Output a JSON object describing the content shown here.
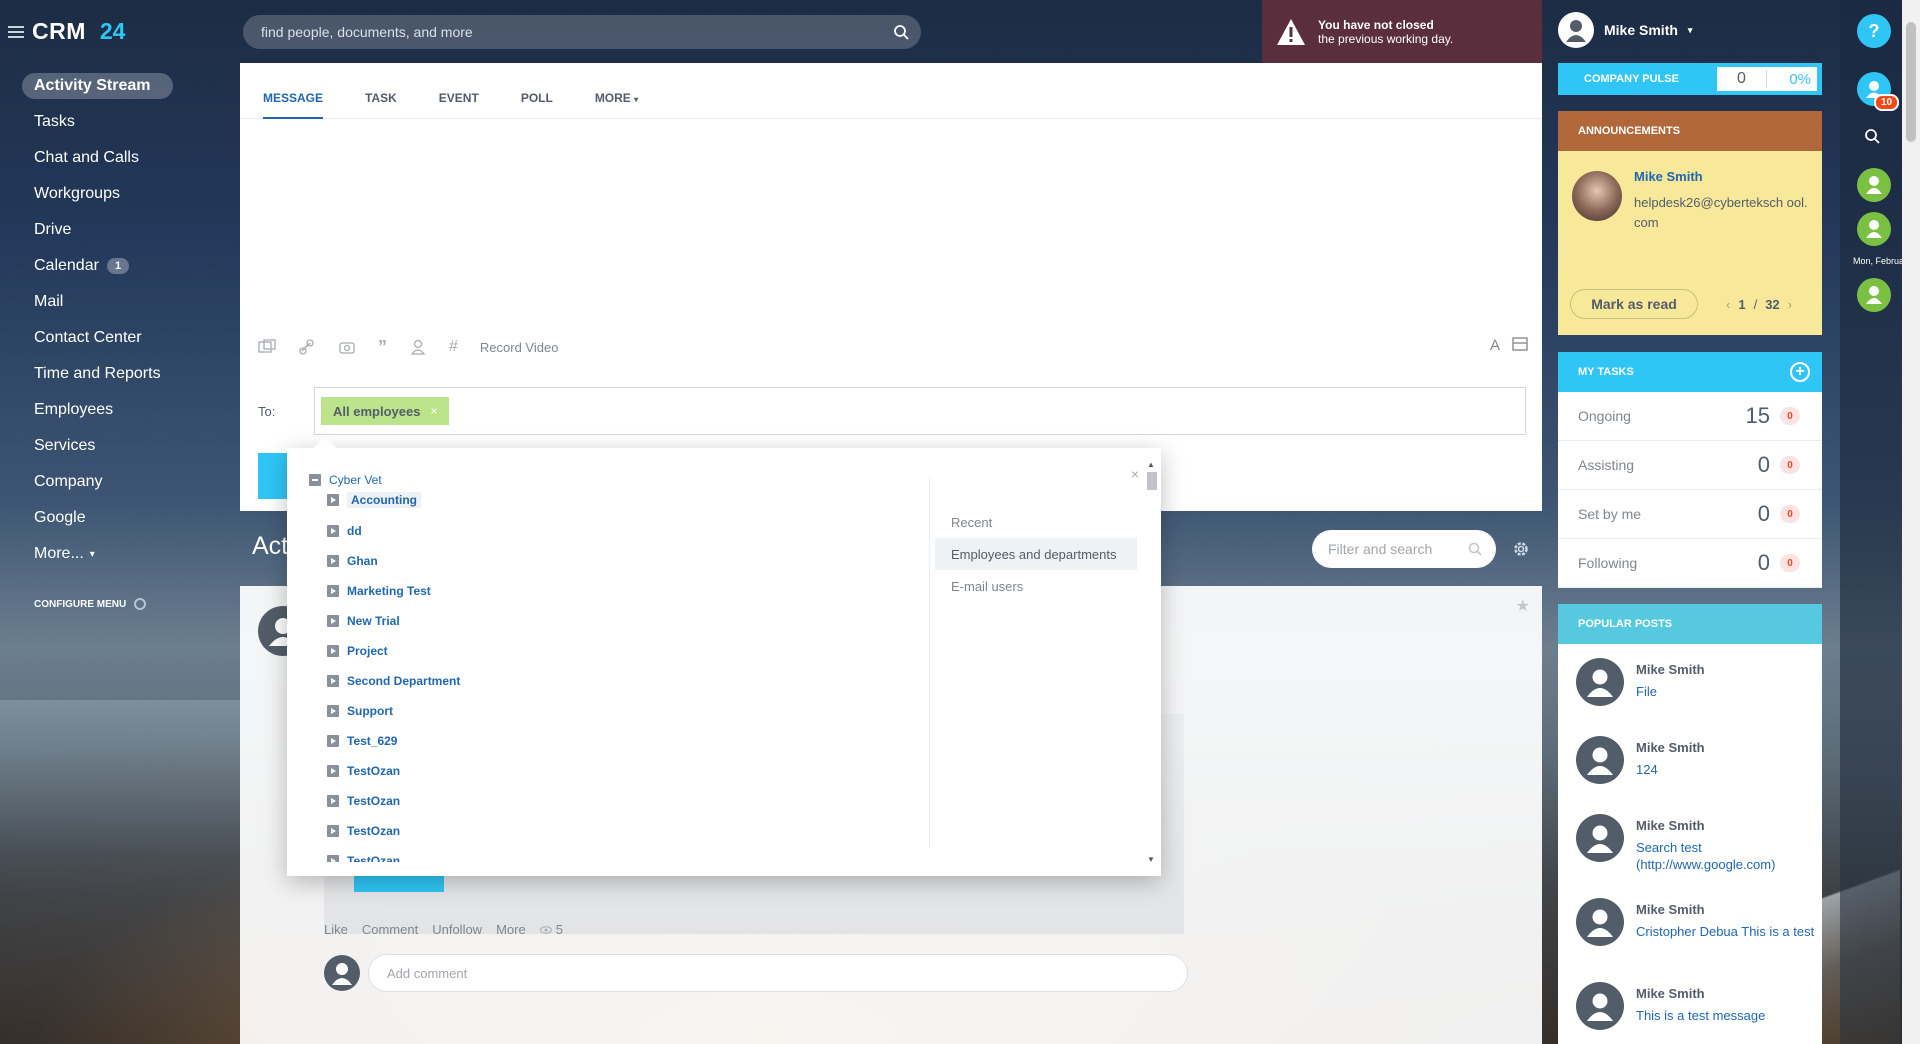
{
  "app": {
    "name": "CRM",
    "name_suffix": "24"
  },
  "leftmenu": {
    "items": [
      {
        "label": "Activity Stream",
        "active": true
      },
      {
        "label": "Tasks"
      },
      {
        "label": "Chat and Calls"
      },
      {
        "label": "Workgroups"
      },
      {
        "label": "Drive"
      },
      {
        "label": "Calendar",
        "counter": "1"
      },
      {
        "label": "Mail"
      },
      {
        "label": "Contact Center"
      },
      {
        "label": "Time and Reports"
      },
      {
        "label": "Employees"
      },
      {
        "label": "Services"
      },
      {
        "label": "Company"
      },
      {
        "label": "Google"
      },
      {
        "label": "More..."
      }
    ],
    "configure_label": "CONFIGURE MENU"
  },
  "search": {
    "placeholder": "find people, documents, and more"
  },
  "warning": {
    "line1": "You have not closed",
    "line2": "the previous working day."
  },
  "composer": {
    "tabs": [
      "MESSAGE",
      "TASK",
      "EVENT",
      "POLL",
      "MORE"
    ],
    "record_video": "Record Video",
    "to_label": "To:",
    "recipient_tag": "All employees",
    "tag_remove": "×"
  },
  "popup": {
    "close": "×",
    "root": "Cyber Vet",
    "departments": [
      "Accounting",
      "dd",
      "Ghan",
      "Marketing Test",
      "New Trial",
      "Project",
      "Second Department",
      "Support",
      "Test_629",
      "TestOzan",
      "TestOzan",
      "TestOzan",
      "TestOzan"
    ],
    "side_items": [
      {
        "label": "Recent"
      },
      {
        "label": "Employees and departments",
        "active": true
      },
      {
        "label": "E-mail users"
      }
    ]
  },
  "stream": {
    "title_partial": "Act",
    "filter_placeholder": "Filter and search",
    "post_actions": [
      "Like",
      "Comment",
      "Unfollow",
      "More"
    ],
    "views": "5",
    "comment_placeholder": "Add comment"
  },
  "user": {
    "name": "Mike Smith"
  },
  "pulse": {
    "label": "COMPANY PULSE",
    "value": "0",
    "percent": "0%"
  },
  "announcements": {
    "title": "ANNOUNCEMENTS",
    "author": "Mike Smith",
    "text": "helpdesk26@cyberteksch ool.com",
    "mark_read": "Mark as read",
    "page_current": "1",
    "page_sep": "/",
    "page_total": "32"
  },
  "mytasks": {
    "title": "MY TASKS",
    "rows": [
      {
        "label": "Ongoing",
        "count": "15",
        "badge": "0"
      },
      {
        "label": "Assisting",
        "count": "0",
        "badge": "0"
      },
      {
        "label": "Set by me",
        "count": "0",
        "badge": "0"
      },
      {
        "label": "Following",
        "count": "0",
        "badge": "0"
      }
    ]
  },
  "popular": {
    "title": "POPULAR POSTS",
    "items": [
      {
        "author": "Mike Smith",
        "text": "File"
      },
      {
        "author": "Mike Smith",
        "text": "124"
      },
      {
        "author": "Mike Smith",
        "text": "Search test (http://www.google.com)"
      },
      {
        "author": "Mike Smith",
        "text": "Cristopher Debua This is a test"
      },
      {
        "author": "Mike Smith",
        "text": "This is a test message"
      }
    ]
  },
  "rail": {
    "help": "?",
    "notif_count": "10",
    "date": "Mon, Februar"
  },
  "colors": {
    "accent": "#2fc6f6",
    "link": "#2067b0",
    "announce_header": "#b0683a",
    "announce_body": "#f8e99a",
    "tag": "#bce58b",
    "warning_bg": "#5b2e3e"
  }
}
